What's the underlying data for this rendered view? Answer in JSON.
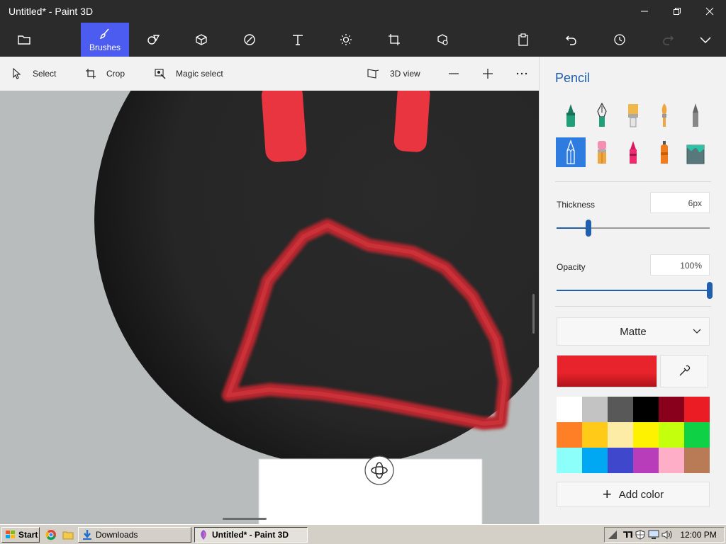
{
  "window": {
    "title": "Untitled* - Paint 3D"
  },
  "ribbon": {
    "active_label": "Brushes"
  },
  "toolbar": {
    "select": "Select",
    "crop": "Crop",
    "magic_select": "Magic select",
    "view3d": "3D view"
  },
  "panel": {
    "title": "Pencil",
    "thickness_label": "Thickness",
    "thickness_value": "6px",
    "thickness_fraction": 0.21,
    "opacity_label": "Opacity",
    "opacity_value": "100%",
    "opacity_fraction": 1.0,
    "finish": "Matte",
    "current_color": "#e8232b",
    "add_color": "Add color",
    "palette": [
      "#ffffff",
      "#c3c3c3",
      "#585858",
      "#000000",
      "#88001b",
      "#ec1c24",
      "#ff7f27",
      "#ffca18",
      "#fdeca6",
      "#fff200",
      "#c4ff0e",
      "#0ed145",
      "#8cfffb",
      "#00a8f3",
      "#3f48cc",
      "#b83dba",
      "#ffaec8",
      "#b97a56"
    ]
  },
  "taskbar": {
    "start": "Start",
    "downloads": "Downloads",
    "active_app": "Untitled* - Paint 3D",
    "clock": "12:00 PM"
  },
  "colors": {
    "accent": "#4c5bf0",
    "panel_accent": "#1f5fae"
  }
}
